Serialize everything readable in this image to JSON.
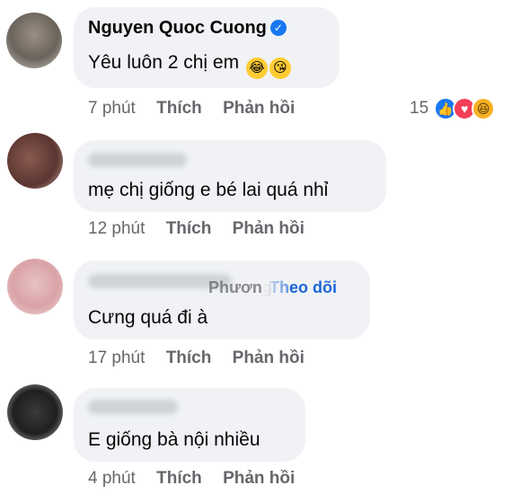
{
  "comments": [
    {
      "author": "Nguyen Quoc Cuong",
      "verified_icon": "verified-badge-icon",
      "text": "Yêu luôn 2 chị em",
      "emojis": [
        "😂",
        "😘"
      ],
      "time": "7 phút",
      "like_label": "Thích",
      "reply_label": "Phản hồi",
      "reaction_count": "15",
      "reactions": [
        "like-icon",
        "love-icon",
        "haha-icon"
      ]
    },
    {
      "text": "mẹ chị giống e bé lai quá nhỉ",
      "time": "12 phút",
      "like_label": "Thích",
      "reply_label": "Phản hồi"
    },
    {
      "author_visible": "Phương",
      "follow_label": "Theo dõi",
      "text": "Cưng quá đi à",
      "time": "17 phút",
      "like_label": "Thích",
      "reply_label": "Phản hồi"
    },
    {
      "text": "E giống bà nội nhiều",
      "time": "4 phút",
      "like_label": "Thích",
      "reply_label": "Phản hồi"
    }
  ],
  "colors": {
    "bubble": "#f0f2f5",
    "meta_text": "#65676b",
    "link_blue": "#1b64d8",
    "like_blue": "#1877f2",
    "love_red": "#f33e58",
    "haha_yellow": "#f7b125"
  }
}
